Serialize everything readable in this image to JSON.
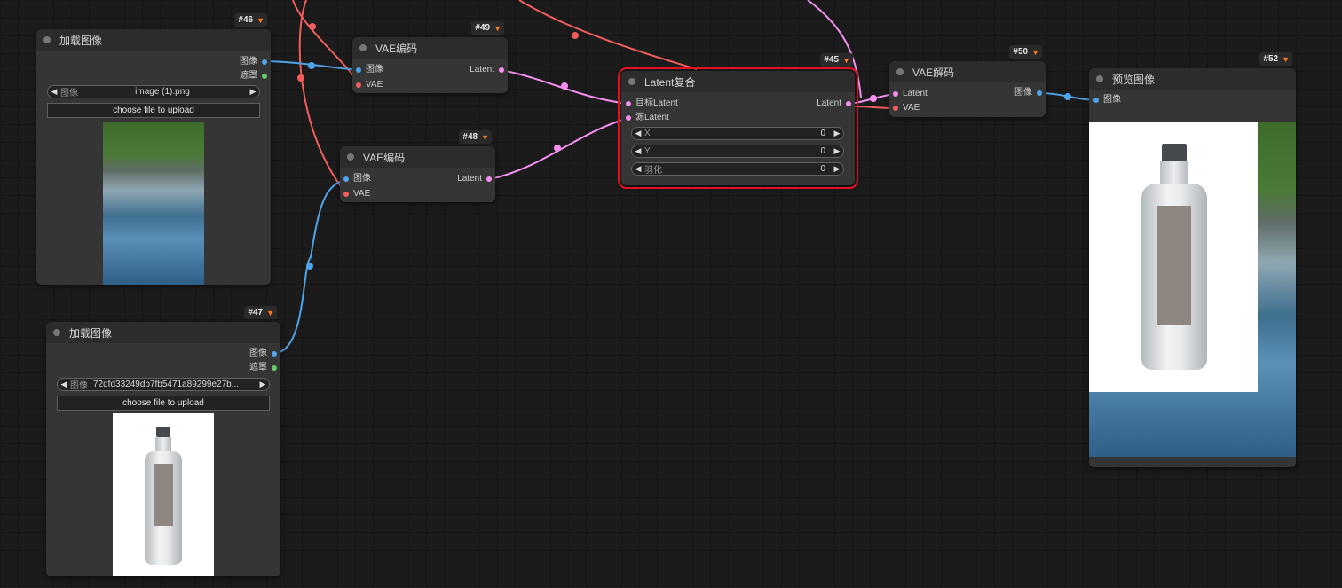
{
  "colors": {
    "wire_blue": "#4fa3e8",
    "wire_red": "#f05d5d",
    "wire_pink": "#f48ff0",
    "selection": "#e3101f",
    "badge_fox": "#ff7a1a"
  },
  "nodes": {
    "n46": {
      "badge": "#46",
      "title": "加载图像",
      "out_image": "图像",
      "out_mask": "遮罩",
      "combo_label": "图像",
      "combo_value": "image (1).png",
      "upload_label": "choose file to upload"
    },
    "n47": {
      "badge": "#47",
      "title": "加载图像",
      "out_image": "图像",
      "out_mask": "遮罩",
      "combo_label": "图像",
      "combo_value": "72dfd33249db7fb5471a89299e27b...",
      "upload_label": "choose file to upload"
    },
    "n49": {
      "badge": "#49",
      "title": "VAE编码",
      "in_image": "图像",
      "in_vae": "VAE",
      "out_latent": "Latent"
    },
    "n48": {
      "badge": "#48",
      "title": "VAE编码",
      "in_image": "图像",
      "in_vae": "VAE",
      "out_latent": "Latent"
    },
    "n45": {
      "badge": "#45",
      "title": "Latent复合",
      "in_target": "目标Latent",
      "in_source": "源Latent",
      "out_latent": "Latent",
      "x_label": "X",
      "x_value": "0",
      "y_label": "Y",
      "y_value": "0",
      "feather_label": "羽化",
      "feather_value": "0"
    },
    "n50": {
      "badge": "#50",
      "title": "VAE解码",
      "in_latent": "Latent",
      "in_vae": "VAE",
      "out_image": "图像"
    },
    "n52": {
      "badge": "#52",
      "title": "预览图像",
      "in_image": "图像"
    }
  }
}
